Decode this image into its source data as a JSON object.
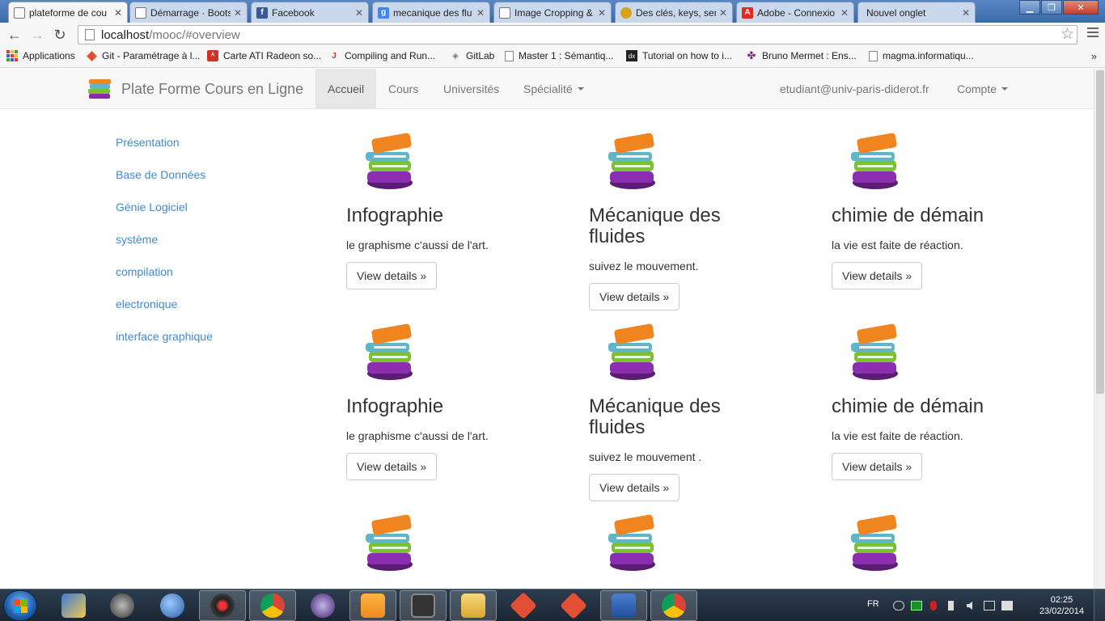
{
  "browser": {
    "tabs": [
      {
        "title": "plateforme de cou",
        "icon": "document-icon",
        "active": true
      },
      {
        "title": "Démarrage · Boots",
        "icon": "document-icon",
        "active": false
      },
      {
        "title": "Facebook",
        "icon": "facebook-icon",
        "active": false
      },
      {
        "title": "mecanique des flu",
        "icon": "google-icon",
        "active": false
      },
      {
        "title": "Image Cropping &",
        "icon": "document-icon",
        "active": false
      },
      {
        "title": "Des clés, keys, seri",
        "icon": "key-icon",
        "active": false
      },
      {
        "title": "Adobe - Connexio",
        "icon": "adobe-icon",
        "active": false
      },
      {
        "title": "Nouvel onglet",
        "icon": "none",
        "active": false
      }
    ],
    "address_host": "localhost",
    "address_path": "/mooc/#overview",
    "bookmarks": [
      {
        "label": "Applications",
        "icon": "apps-grid-icon"
      },
      {
        "label": "Git - Paramétrage à l...",
        "icon": "git-icon"
      },
      {
        "label": "Carte ATI Radeon so...",
        "icon": "ati-icon"
      },
      {
        "label": "Compiling and Run...",
        "icon": "java-icon"
      },
      {
        "label": "GitLab",
        "icon": "gitlab-icon"
      },
      {
        "label": "Master 1 : Sémantiq...",
        "icon": "document-icon"
      },
      {
        "label": "Tutorial on how to i...",
        "icon": "tutorial-icon"
      },
      {
        "label": "Bruno Mermet : Ens...",
        "icon": "puzzle-icon"
      },
      {
        "label": "magma.informatiqu...",
        "icon": "document-icon"
      }
    ],
    "bookmarks_more": "»"
  },
  "navbar": {
    "brand": "Plate Forme Cours en Ligne",
    "links": [
      "Accueil",
      "Cours",
      "Universités",
      "Spécialité"
    ],
    "active": "Accueil",
    "user_email": "etudiant@univ-paris-diderot.fr",
    "account": "Compte"
  },
  "sidebar": {
    "items": [
      "Présentation",
      "Base de Données",
      "Génie Logiciel",
      "système",
      "compilation",
      "electronique",
      "interface graphique"
    ]
  },
  "courses": {
    "button_label": "View details »",
    "rows": [
      [
        {
          "title": "Infographie",
          "desc": "le graphisme c'aussi de l'art."
        },
        {
          "title": "Mécanique des fluides",
          "desc": "suivez le mouvement."
        },
        {
          "title": "chimie de démain",
          "desc": "la vie est faite de réaction."
        }
      ],
      [
        {
          "title": "Infographie",
          "desc": "le graphisme c'aussi de l'art."
        },
        {
          "title": "Mécanique des fluides",
          "desc": "suivez le mouvement ."
        },
        {
          "title": "chimie de démain",
          "desc": "la vie est faite de réaction."
        }
      ]
    ]
  },
  "taskbar": {
    "language": "FR",
    "time": "02:25",
    "date": "23/02/2014"
  },
  "colors": {
    "link": "#428bca",
    "navbar_bg": "#f8f8f8",
    "navbar_active": "#e7e7e7",
    "tabstrip": "#3c6aa8",
    "taskbar": "#1b2633"
  }
}
